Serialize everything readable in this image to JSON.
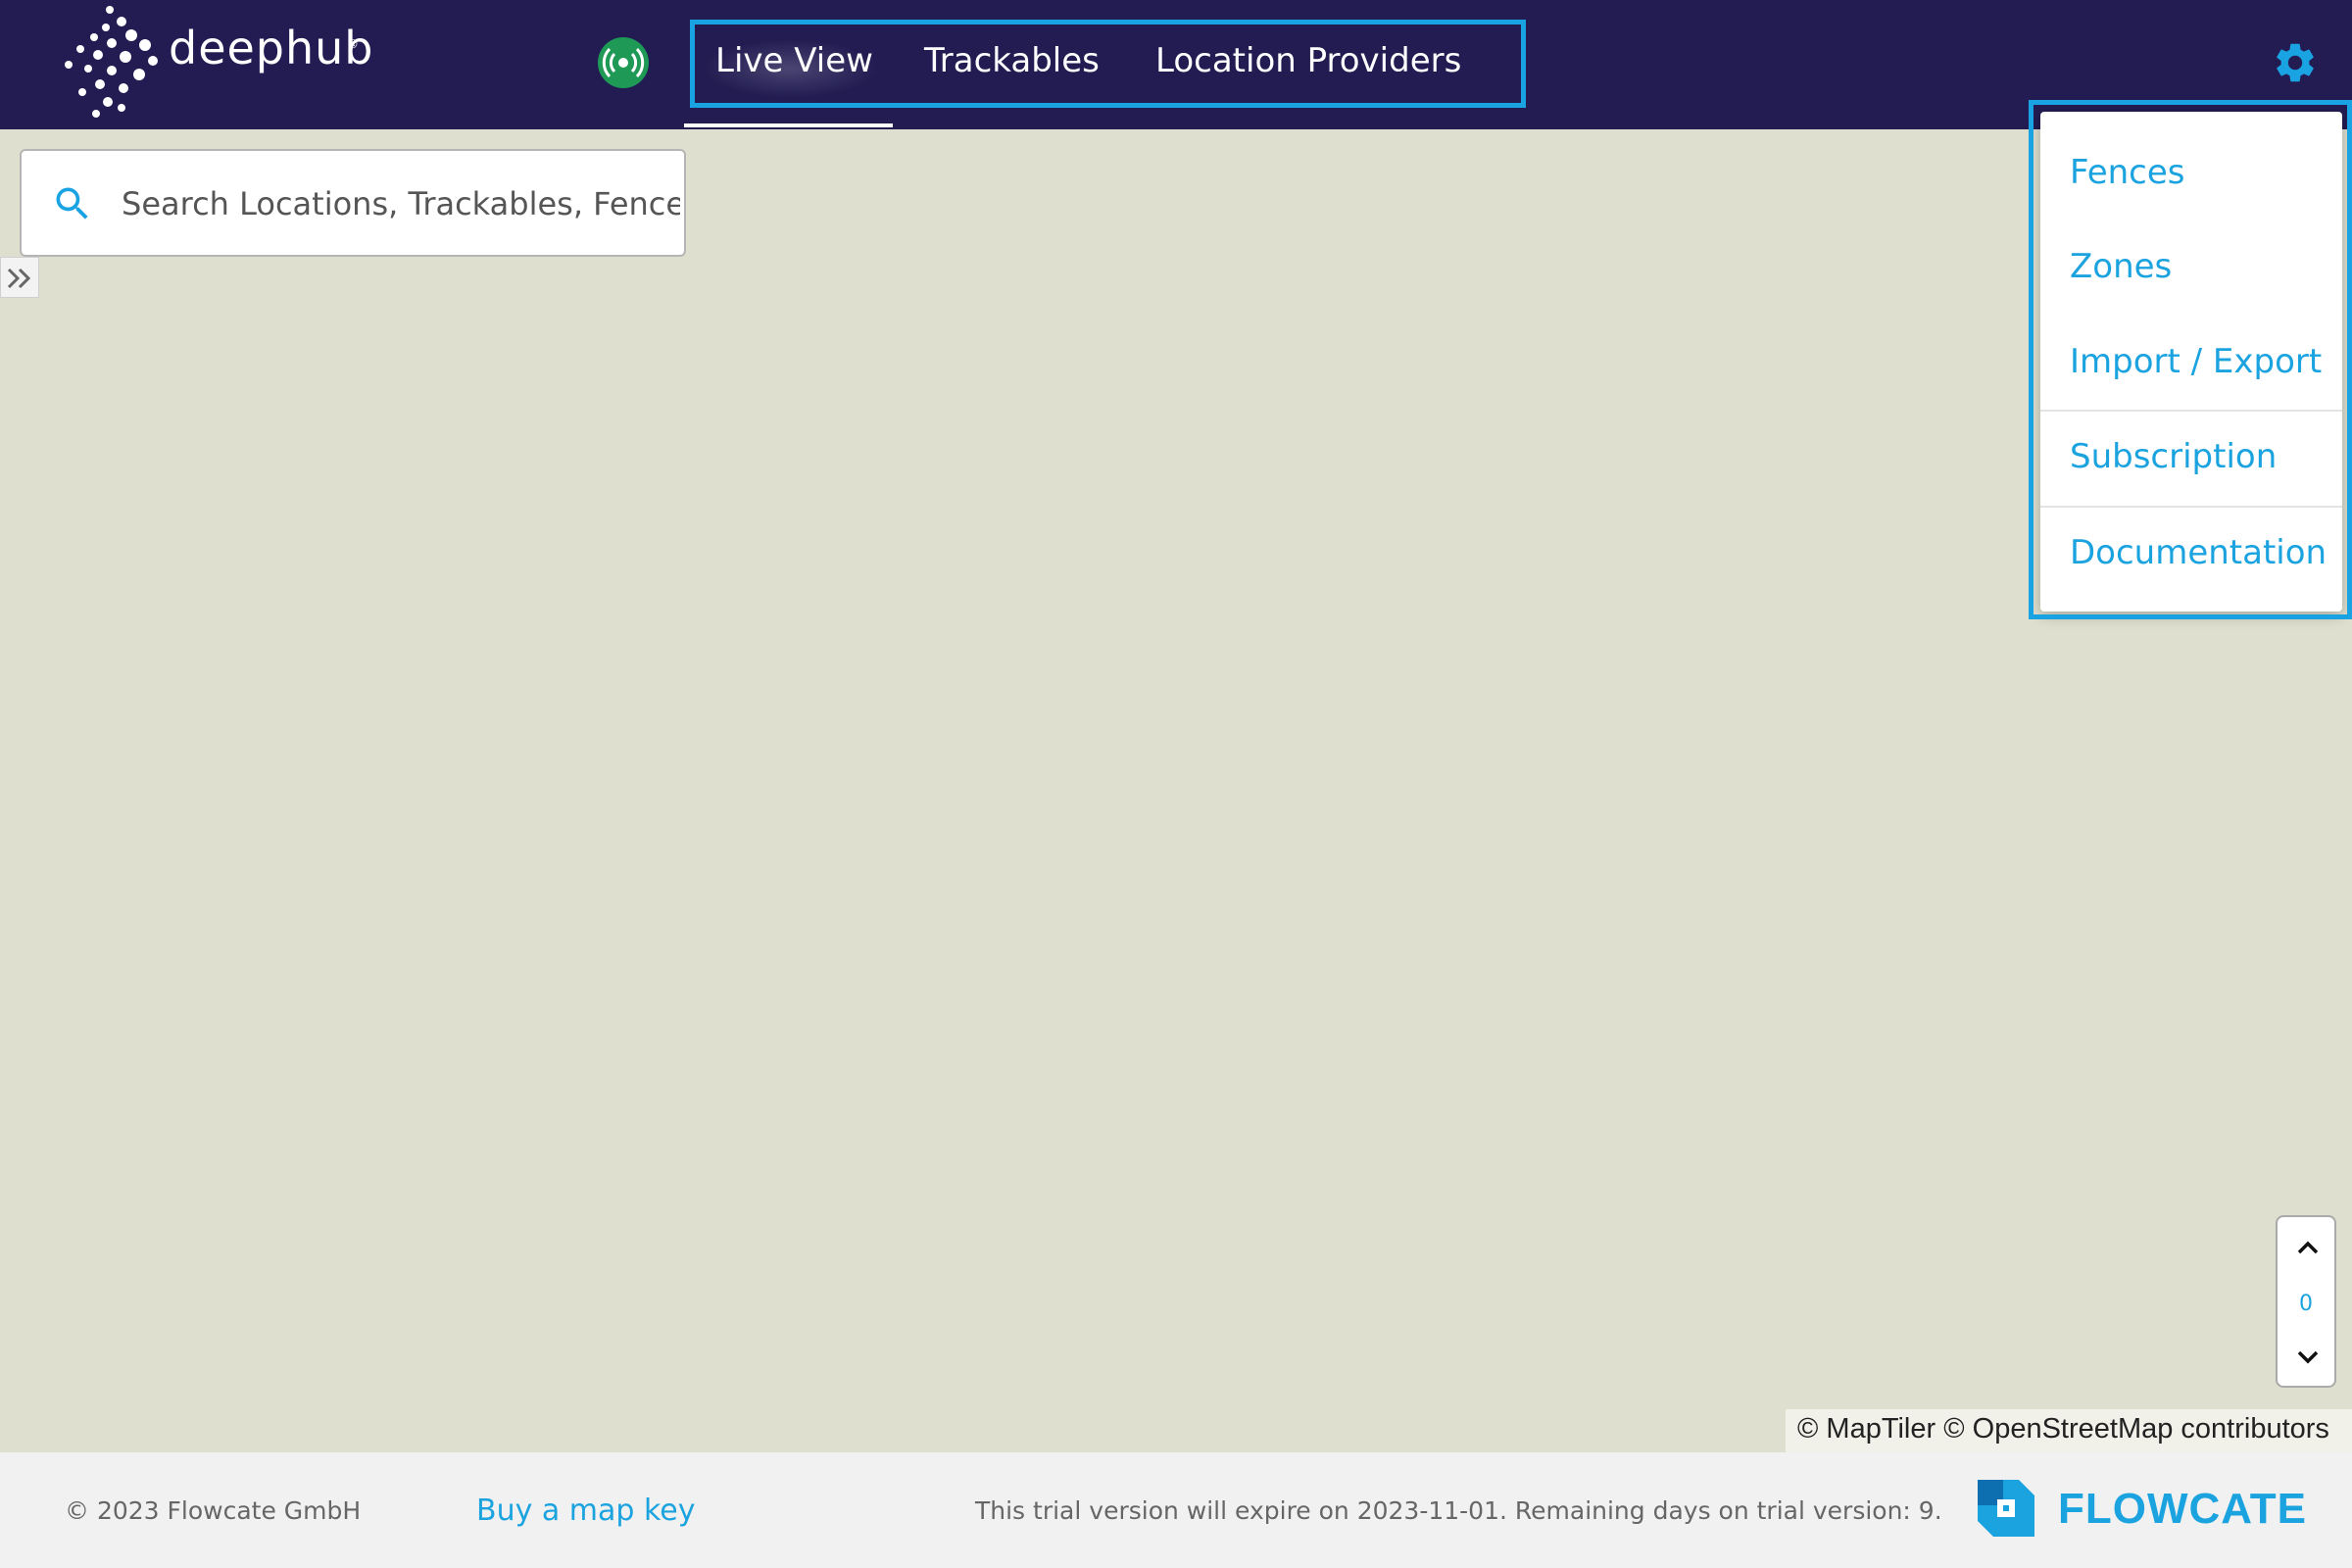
{
  "header": {
    "logo_text": "deephub",
    "logo_mark": "®",
    "connection_status_icon": "broadcast-icon",
    "connection_status_color": "#1f9a56",
    "nav": [
      {
        "label": "Live View",
        "active": true
      },
      {
        "label": "Trackables",
        "active": false
      },
      {
        "label": "Location Providers",
        "active": false
      }
    ],
    "settings_icon": "gear-icon",
    "accent_color": "#1aa3e3",
    "background_color": "#221c52"
  },
  "search": {
    "placeholder": "Search Locations, Trackables, Fences, Zones",
    "icon": "search-icon"
  },
  "settings_menu": {
    "items": [
      "Fences",
      "Zones",
      "Import / Export",
      "Subscription",
      "Documentation"
    ]
  },
  "level_control": {
    "value": "0",
    "up_icon": "chevron-up-icon",
    "down_icon": "chevron-down-icon"
  },
  "map": {
    "attribution": "© MapTiler © OpenStreetMap contributors",
    "background_color": "#dfdfcf"
  },
  "footer": {
    "copyright": "© 2023 Flowcate GmbH",
    "buy_map_key": "Buy a map key",
    "trial_notice": "This trial version will expire on 2023-11-01. Remaining days on trial version: 9.",
    "brand": "FLOWCATE"
  }
}
